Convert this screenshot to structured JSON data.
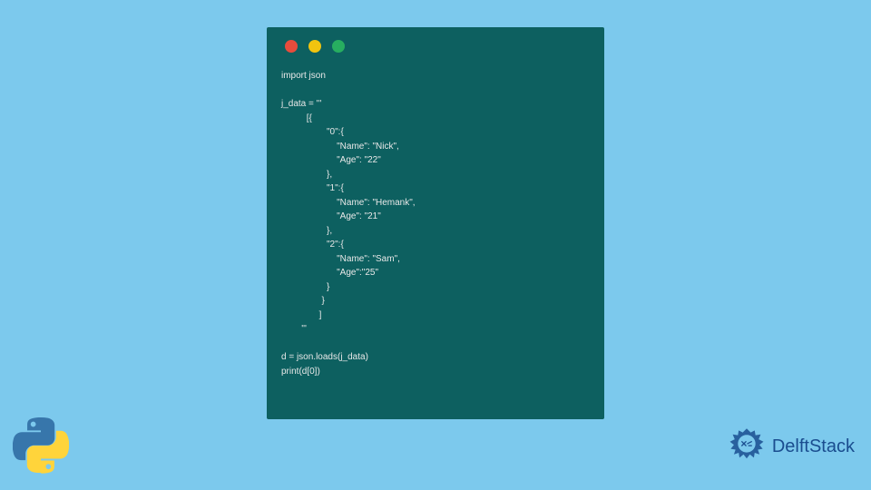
{
  "code": {
    "lines": "import json\n\nj_data = '''\n          [{\n                  \"0\":{\n                      \"Name\": \"Nick\",\n                      \"Age\": \"22\"\n                  },\n                  \"1\":{\n                      \"Name\": \"Hemank\",\n                      \"Age\": \"21\"\n                  },\n                  \"2\":{\n                      \"Name\": \"Sam\",\n                      \"Age\":\"25\"\n                  }\n                }\n               ]\n        '''\n\nd = json.loads(j_data)\nprint(d[0])"
  },
  "brand": {
    "name": "DelftStack"
  }
}
